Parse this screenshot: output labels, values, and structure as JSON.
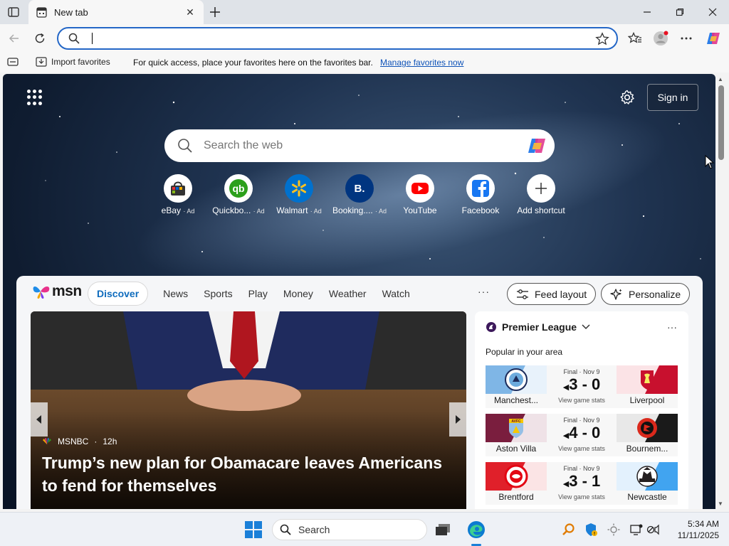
{
  "browser": {
    "tab_title": "New tab",
    "omnibox_value": "",
    "favorites_bar": {
      "import_label": "Import favorites",
      "tip": "For quick access, place your favorites here on the favorites bar.",
      "manage_link": "Manage favorites now"
    }
  },
  "newtab": {
    "signin_label": "Sign in",
    "search_placeholder": "Search the web",
    "shortcuts": [
      {
        "label": "eBay",
        "ad": "· Ad",
        "icon": "ebay-icon"
      },
      {
        "label": "Quickbo...",
        "ad": "· Ad",
        "icon": "quickbooks-icon"
      },
      {
        "label": "Walmart",
        "ad": "· Ad",
        "icon": "walmart-icon"
      },
      {
        "label": "Booking....",
        "ad": "· Ad",
        "icon": "booking-icon"
      },
      {
        "label": "YouTube",
        "ad": "",
        "icon": "youtube-icon"
      },
      {
        "label": "Facebook",
        "ad": "",
        "icon": "facebook-icon"
      },
      {
        "label": "Add shortcut",
        "ad": "",
        "icon": "plus-icon"
      }
    ]
  },
  "feed": {
    "logo_text": "msn",
    "tabs": [
      "Discover",
      "News",
      "Sports",
      "Play",
      "Money",
      "Weather",
      "Watch"
    ],
    "more_label": "···",
    "feed_layout_label": "Feed layout",
    "personalize_label": "Personalize",
    "hero": {
      "source": "MSNBC",
      "age": "12h",
      "headline": "Trump’s new plan for Obamacare leaves Americans to fend for themselves"
    },
    "sports": {
      "league": "Premier League",
      "subtitle": "Popular in your area",
      "more_label": "···",
      "matches": [
        {
          "status": "Final · Nov 9",
          "score": "3 - 0",
          "stats": "View game stats",
          "home": "Manchest...",
          "away": "Liverpool",
          "home_color": "#7fb6e6",
          "away_color": "#c8102e"
        },
        {
          "status": "Final · Nov 9",
          "score": "4 - 0",
          "stats": "View game stats",
          "home": "Aston Villa",
          "away": "Bournem...",
          "home_color": "#7a1e3e",
          "away_color": "#1a1a1a"
        },
        {
          "status": "Final · Nov 9",
          "score": "3 - 1",
          "stats": "View game stats",
          "home": "Brentford",
          "away": "Newcastle",
          "home_color": "#e0202a",
          "away_color": "#41a4f0"
        }
      ]
    }
  },
  "taskbar": {
    "search_label": "Search",
    "time": "5:34 AM",
    "date": "11/11/2025"
  },
  "colors": {
    "accent": "#0f6cbd",
    "omnibox_border": "#2467c7",
    "link": "#0f53b8"
  }
}
